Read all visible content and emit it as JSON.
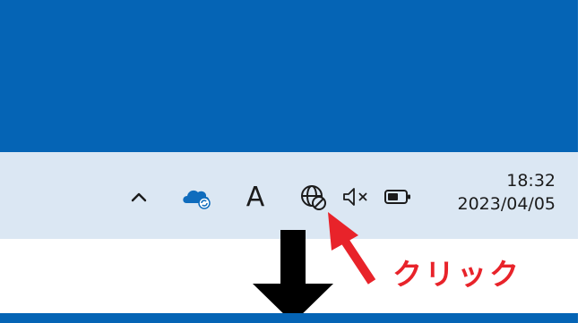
{
  "taskbar": {
    "tray_icons": [
      {
        "name": "chevron-up-icon"
      },
      {
        "name": "onedrive-sync-icon"
      },
      {
        "name": "input-indicator"
      },
      {
        "name": "network-no-internet-icon"
      },
      {
        "name": "volume-muted-icon"
      },
      {
        "name": "battery-icon"
      }
    ],
    "ime_label": "A",
    "clock": {
      "time": "18:32",
      "date": "2023/04/05"
    }
  },
  "annotation": {
    "label": "クリック"
  },
  "colors": {
    "desktop": "#0564b5",
    "taskbar": "#dbe7f3",
    "annotation": "#e8232a",
    "down_arrow": "#000000"
  }
}
